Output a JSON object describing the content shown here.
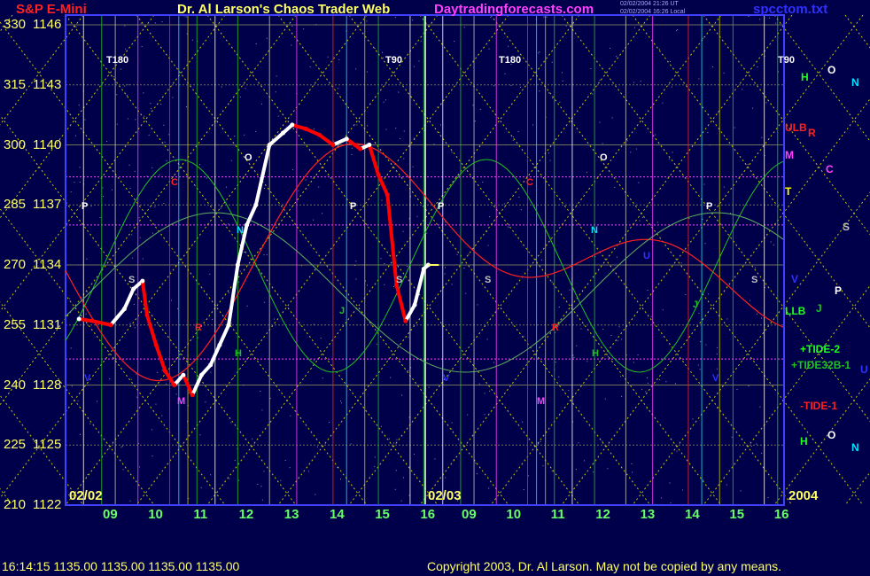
{
  "header": {
    "symbol": "S&P E-Mini",
    "title": "Dr. Al Larson's Chaos Trader Web",
    "site": "Daytradingforecasts.com",
    "timestamp_line1": "02/02/2004 21:26 UT",
    "timestamp_line2": "02/02/2004 16:26 Local",
    "filename": "spcctom.txt"
  },
  "colors": {
    "background": "#00004a",
    "frame": "#4040ff",
    "price_up": "#ffffff",
    "price_down": "#ff0000",
    "forecast_red": "#ff2020",
    "forecast_green": "#20c020",
    "grid_yellow": "#c8c800"
  },
  "chart_data": {
    "type": "line",
    "title": "S&P E-Mini",
    "ylim": [
      1122,
      1146
    ],
    "y_ticks": [
      {
        "tide": "330",
        "price": "1146"
      },
      {
        "tide": "315",
        "price": "1143"
      },
      {
        "tide": "300",
        "price": "1140"
      },
      {
        "tide": "285",
        "price": "1137"
      },
      {
        "tide": "270",
        "price": "1134"
      },
      {
        "tide": "255",
        "price": "1131"
      },
      {
        "tide": "240",
        "price": "1128"
      },
      {
        "tide": "225",
        "price": "1125"
      },
      {
        "tide": "210",
        "price": "1122"
      }
    ],
    "x_ticks": [
      "09",
      "10",
      "11",
      "12",
      "13",
      "14",
      "15",
      "16",
      "09",
      "10",
      "11",
      "12",
      "13",
      "14",
      "15",
      "16"
    ],
    "date_labels": {
      "day1": "02/02",
      "day2": "02/03",
      "year": "2004"
    },
    "price_series": {
      "name": "S&P E-Mini",
      "hours": [
        8.3,
        8.6,
        9.0,
        9.3,
        9.5,
        9.7,
        9.8,
        10.0,
        10.2,
        10.4,
        10.6,
        10.8,
        11.0,
        11.2,
        11.4,
        11.6,
        11.8,
        12.0,
        12.2,
        12.5,
        12.8,
        13.0,
        13.3,
        13.6,
        13.9,
        14.2,
        14.5,
        14.7,
        14.9,
        15.1,
        15.3,
        15.5,
        15.7,
        15.9,
        16.0
      ],
      "values": [
        1131.3,
        1131.2,
        1131.0,
        1131.8,
        1132.8,
        1133.2,
        1131.5,
        1130.0,
        1128.7,
        1128.0,
        1128.5,
        1127.5,
        1128.5,
        1129.0,
        1130.0,
        1131.0,
        1134.0,
        1136.0,
        1137.0,
        1140.0,
        1140.6,
        1141.0,
        1140.8,
        1140.5,
        1140.0,
        1140.3,
        1139.8,
        1140.0,
        1138.5,
        1137.5,
        1133.0,
        1131.2,
        1132.0,
        1133.8,
        1134.0
      ]
    },
    "forecast_labels": [
      {
        "text": "T180",
        "color": "#ffffff"
      },
      {
        "text": "T90",
        "color": "#ffffff"
      },
      {
        "text": "P",
        "color": "#ffffff"
      },
      {
        "text": "C",
        "color": "#ff2020"
      },
      {
        "text": "O",
        "color": "#ffffff"
      },
      {
        "text": "N",
        "color": "#00e0ff"
      },
      {
        "text": "S",
        "color": "#c0c0c0"
      },
      {
        "text": "R",
        "color": "#ff2020"
      },
      {
        "text": "H",
        "color": "#20c020"
      },
      {
        "text": "M",
        "color": "#ff40ff"
      },
      {
        "text": "V",
        "color": "#3030ff"
      },
      {
        "text": "J",
        "color": "#20c020"
      },
      {
        "text": "U",
        "color": "#3030ff"
      }
    ],
    "legend_right": [
      {
        "text": "ULB",
        "color": "#ff2020"
      },
      {
        "text": "M",
        "color": "#ff40ff"
      },
      {
        "text": "T",
        "color": "#ffff00"
      },
      {
        "text": "LLB",
        "color": "#20ff20"
      },
      {
        "text": "+TIDE-2",
        "color": "#20ff20"
      },
      {
        "text": "+TIDE32B-1",
        "color": "#20c020"
      },
      {
        "text": "-TIDE-1",
        "color": "#ff2020"
      },
      {
        "text": "H",
        "color": "#20ff20"
      },
      {
        "text": "O",
        "color": "#ffffff"
      },
      {
        "text": "N",
        "color": "#00e0ff"
      },
      {
        "text": "R",
        "color": "#ff2020"
      },
      {
        "text": "C",
        "color": "#ff40ff"
      },
      {
        "text": "S",
        "color": "#c0c0c0"
      },
      {
        "text": "V",
        "color": "#3030ff"
      },
      {
        "text": "P",
        "color": "#ffffff"
      },
      {
        "text": "J",
        "color": "#20c020"
      },
      {
        "text": "U",
        "color": "#3030ff"
      }
    ]
  },
  "footer": {
    "quote": "16:14:15  1135.00 1135.00 1135.00 1135.00",
    "copyright": "Copyright 2003, Dr. Al Larson. May not be copied by any means."
  }
}
